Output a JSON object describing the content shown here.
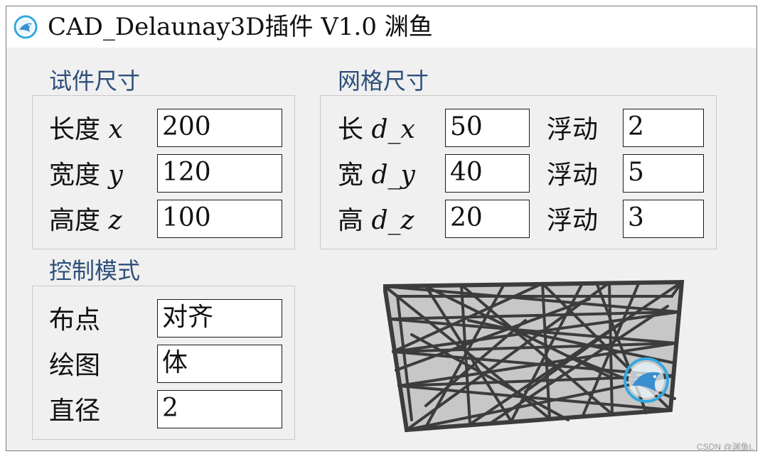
{
  "window": {
    "title": "CAD_Delaunay3D插件 V1.0 渊鱼",
    "icon": "fish-logo-icon"
  },
  "specimen_size": {
    "title": "试件尺寸",
    "rows": [
      {
        "label": "长度",
        "var": "x",
        "value": "200"
      },
      {
        "label": "宽度",
        "var": "y",
        "value": "120"
      },
      {
        "label": "高度",
        "var": "z",
        "value": "100"
      }
    ]
  },
  "mesh_size": {
    "title": "网格尺寸",
    "rows": [
      {
        "label": "长",
        "var": "d_x",
        "value": "50",
        "float_label": "浮动",
        "float_value": "2"
      },
      {
        "label": "宽",
        "var": "d_y",
        "value": "40",
        "float_label": "浮动",
        "float_value": "5"
      },
      {
        "label": "高",
        "var": "d_z",
        "value": "20",
        "float_label": "浮动",
        "float_value": "3"
      }
    ]
  },
  "control_mode": {
    "title": "控制模式",
    "rows": [
      {
        "label": "布点",
        "value": "对齐"
      },
      {
        "label": "绘图",
        "value": "体"
      },
      {
        "label": "直径",
        "value": "2"
      }
    ]
  },
  "preview": {
    "icon": "fish-logo-icon"
  },
  "watermark": "CSDN @渊鱼L",
  "colors": {
    "group_title": "#2e4f7a",
    "window_bg": "#f0f0f0",
    "icon_blue": "#35a8e0",
    "lattice": "#3c3c3c"
  }
}
